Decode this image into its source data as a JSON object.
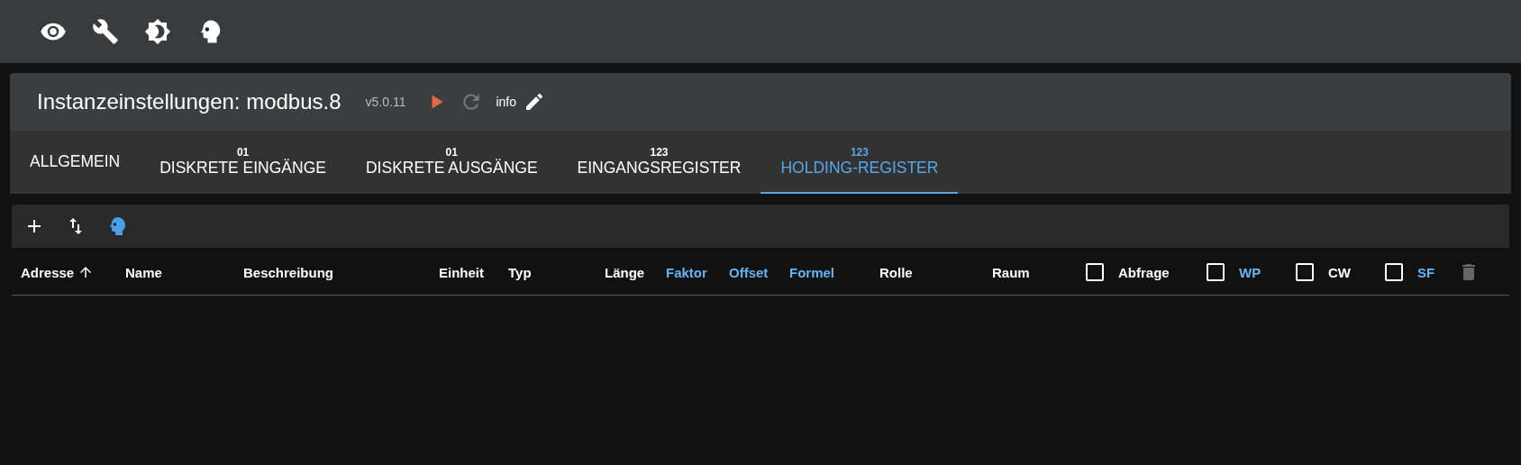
{
  "header": {
    "title": "Instanzeinstellungen: modbus.8",
    "version": "v5.0.11",
    "actions": [
      {
        "kind": "play",
        "disabled": false
      },
      {
        "kind": "reload",
        "disabled": true
      }
    ],
    "info": "info"
  },
  "tabs": [
    {
      "label": "ALLGEMEIN",
      "selected": false
    },
    {
      "label": "DISKRETE EINGÄNGE",
      "badge": "01",
      "selected": false
    },
    {
      "label": "DISKRETE AUSGÄNGE",
      "badge": "01",
      "selected": false
    },
    {
      "label": "EINGANGSREGISTER",
      "badge": "123",
      "selected": false
    },
    {
      "label": "HOLDING-REGISTER",
      "badge": "123",
      "selected": true
    }
  ],
  "table_toolbar": {
    "expert_mode": true
  },
  "table": {
    "columns": [
      {
        "kind": "text",
        "label": "Adresse",
        "highlighted": false,
        "sorted": true
      },
      {
        "kind": "text",
        "label": "Name",
        "highlighted": false,
        "sorted": false
      },
      {
        "kind": "text",
        "label": "Beschreibung",
        "highlighted": false,
        "sorted": false
      },
      {
        "kind": "text",
        "label": "Einheit",
        "highlighted": false,
        "sorted": false
      },
      {
        "kind": "text",
        "label": "Typ",
        "highlighted": false,
        "sorted": false
      },
      {
        "kind": "text",
        "label": "Länge",
        "highlighted": false,
        "sorted": false
      },
      {
        "kind": "text",
        "label": "Faktor",
        "highlighted": true,
        "sorted": false
      },
      {
        "kind": "text",
        "label": "Offset",
        "highlighted": true,
        "sorted": false
      },
      {
        "kind": "text",
        "label": "Formel",
        "highlighted": true,
        "sorted": false
      },
      {
        "kind": "text",
        "label": "Rolle",
        "highlighted": false,
        "sorted": false
      },
      {
        "kind": "text",
        "label": "Raum",
        "highlighted": false,
        "sorted": false
      },
      {
        "kind": "checkbox",
        "label": "Abfrage",
        "highlighted": false,
        "checked": false
      },
      {
        "kind": "checkbox",
        "label": "WP",
        "highlighted": true,
        "checked": false
      },
      {
        "kind": "checkbox",
        "label": "CW",
        "highlighted": false,
        "checked": false
      },
      {
        "kind": "checkbox",
        "label": "SF",
        "highlighted": true,
        "checked": false
      }
    ],
    "delete_disabled": true
  }
}
